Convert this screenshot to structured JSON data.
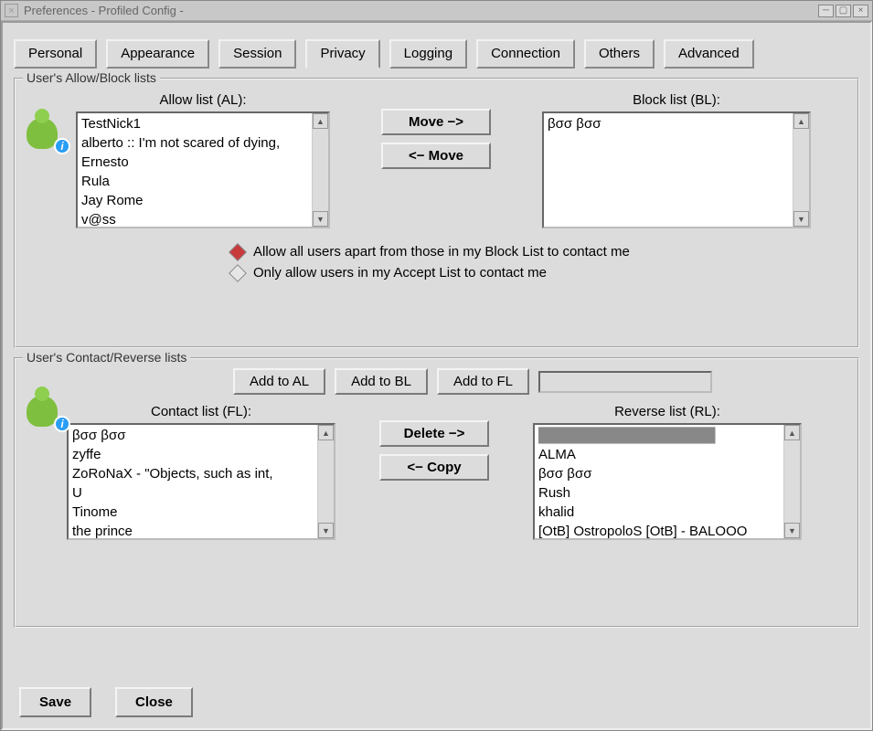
{
  "window": {
    "title": "Preferences - Profiled Config -"
  },
  "tabs": [
    "Personal",
    "Appearance",
    "Session",
    "Privacy",
    "Logging",
    "Connection",
    "Others",
    "Advanced"
  ],
  "section1": {
    "legend": "User's Allow/Block lists",
    "allow_label": "Allow list (AL):",
    "block_label": "Block list (BL):",
    "move_right": "Move −>",
    "move_left": "<− Move",
    "allow_items": [
      "TestNick1",
      "alberto :: I'm not scared of dying,",
      "Ernesto",
      "Rula",
      "Jay Rome",
      "v@ss"
    ],
    "block_items": [
      "βσσ βσσ"
    ],
    "radios": {
      "allow_all": "Allow all users apart from those in my Block List to contact me",
      "only_accept": "Only allow users in my Accept List to contact me"
    }
  },
  "section2": {
    "legend": "User's Contact/Reverse lists",
    "add_al": "Add to AL",
    "add_bl": "Add to BL",
    "add_fl": "Add to FL",
    "contact_label": "Contact list (FL):",
    "reverse_label": "Reverse list (RL):",
    "delete_btn": "Delete −>",
    "copy_btn": "<− Copy",
    "contact_items": [
      "βσσ βσσ",
      "zyffe",
      "ZoRoNaX - \"Objects, such as int,",
      "U",
      "Tinome",
      "the prince"
    ],
    "reverse_items": [
      "████████████████████",
      "ALMA",
      "βσσ βσσ",
      "Rush",
      "khalid",
      "[OtB] OstropoloS [OtB] - BALOOO"
    ]
  },
  "footer": {
    "save": "Save",
    "close": "Close"
  }
}
